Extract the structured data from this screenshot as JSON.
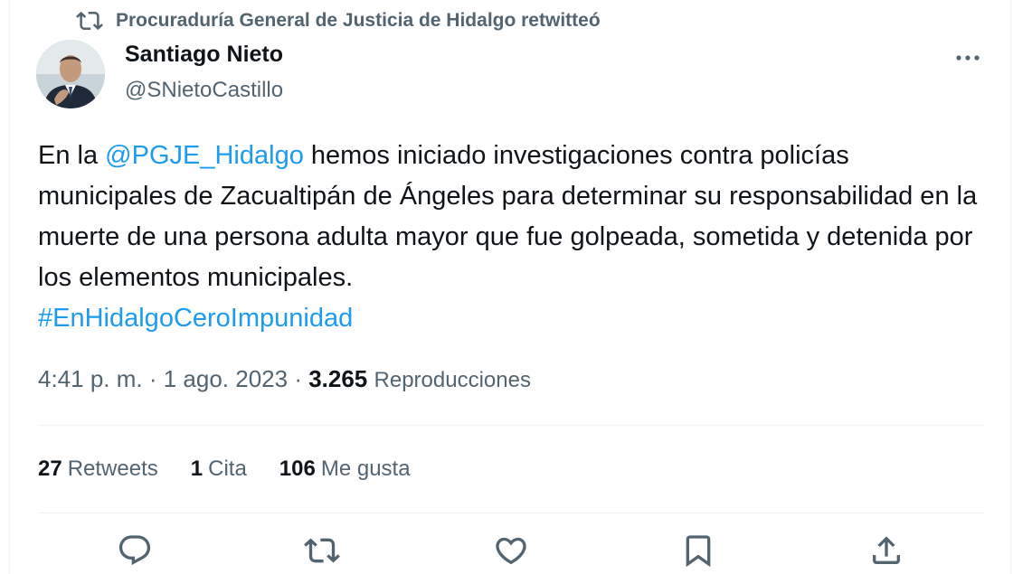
{
  "retweet_header": {
    "icon": "retweet-icon",
    "text": "Procuraduría General de Justicia de Hidalgo retwitteó"
  },
  "author": {
    "name": "Santiago Nieto",
    "handle": "@SNietoCastillo",
    "avatar": "profile-photo"
  },
  "tweet": {
    "text_before": "En la ",
    "mention": "@PGJE_Hidalgo",
    "text_after": " hemos iniciado  investigaciones contra policías municipales de Zacualtipán de Ángeles para determinar su responsabilidad en la muerte de una persona adulta mayor que fue golpeada, sometida y detenida por los elementos municipales.",
    "hashtag": "#EnHidalgoCeroImpunidad"
  },
  "meta": {
    "time": "4:41 p. m.",
    "separator1": " · ",
    "date": "1 ago. 2023",
    "separator2": " · ",
    "views": "3.265",
    "views_label": "Reproducciones"
  },
  "stats": {
    "retweets_count": "27",
    "retweets_label": "Retweets",
    "quotes_count": "1",
    "quotes_label": "Cita",
    "likes_count": "106",
    "likes_label": "Me gusta"
  },
  "actions": [
    "reply-icon",
    "retweet-icon",
    "like-icon",
    "bookmark-icon",
    "share-icon"
  ],
  "colors": {
    "link": "#1d9bf0",
    "secondary_text": "#536471",
    "primary_text": "#0f1419",
    "divider": "#eff3f4"
  }
}
